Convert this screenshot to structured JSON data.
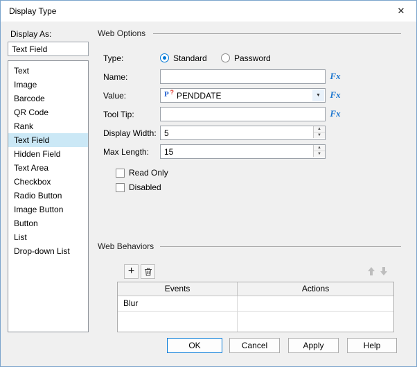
{
  "dialog": {
    "title": "Display Type",
    "close_icon": "✕"
  },
  "display_as": {
    "label": "Display As:",
    "value": "Text Field"
  },
  "type_list": {
    "items": [
      "Text",
      "Image",
      "Barcode",
      "QR Code",
      "Rank",
      "Text Field",
      "Hidden Field",
      "Text Area",
      "Checkbox",
      "Radio Button",
      "Image Button",
      "Button",
      "List",
      "Drop-down List"
    ],
    "selected": "Text Field"
  },
  "web_options": {
    "title": "Web Options",
    "type": {
      "label": "Type:",
      "standard": "Standard",
      "password": "Password",
      "selected": "Standard"
    },
    "name": {
      "label": "Name:",
      "value": "",
      "fx": "Fx"
    },
    "value": {
      "label": "Value:",
      "value": "PENDDATE",
      "fx": "Fx",
      "param_icon_p": "P",
      "param_icon_q": "?",
      "arrow_icon": "▼"
    },
    "tooltip": {
      "label": "Tool Tip:",
      "value": "",
      "fx": "Fx"
    },
    "display_width": {
      "label": "Display Width:",
      "value": "5"
    },
    "max_length": {
      "label": "Max Length:",
      "value": "15"
    },
    "read_only": {
      "label": "Read Only",
      "checked": false
    },
    "disabled": {
      "label": "Disabled",
      "checked": false
    },
    "spinner_up_icon": "▲",
    "spinner_down_icon": "▼"
  },
  "web_behaviors": {
    "title": "Web Behaviors",
    "toolbar": {
      "add_icon": "+",
      "delete_icon": "trash",
      "move_up_icon": "up-arrow",
      "move_down_icon": "down-arrow"
    },
    "table": {
      "headers": [
        "Events",
        "Actions"
      ],
      "rows": [
        {
          "event": "Blur",
          "action": ""
        }
      ]
    }
  },
  "footer": {
    "ok": "OK",
    "cancel": "Cancel",
    "apply": "Apply",
    "help": "Help"
  },
  "colors": {
    "accent": "#0078d7",
    "selection": "#cbe8f6",
    "fx_blue": "#1a75cf"
  }
}
